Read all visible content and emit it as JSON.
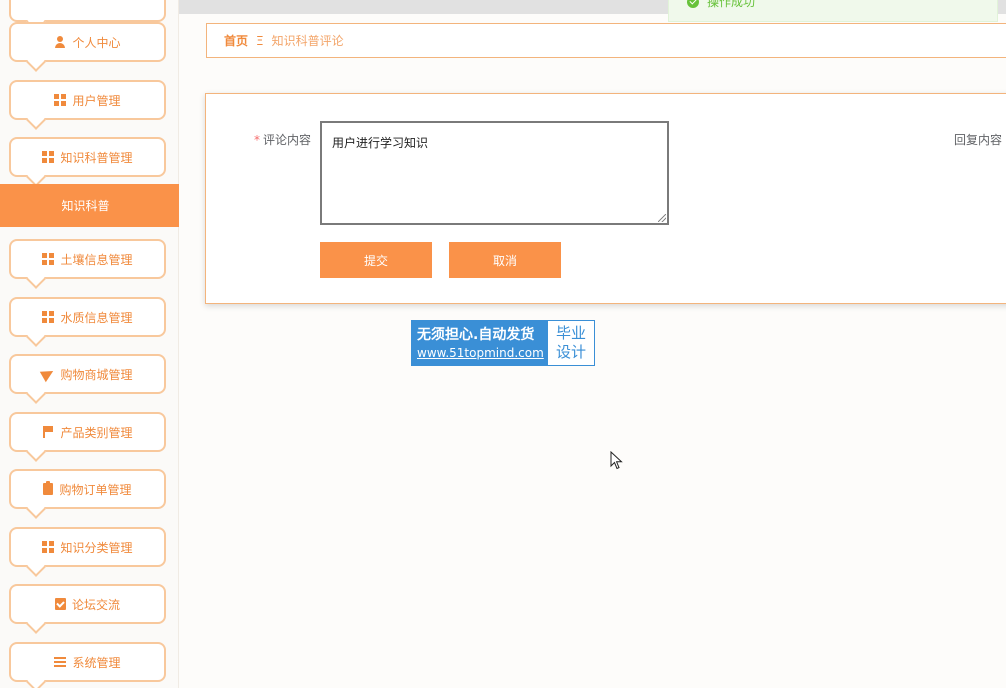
{
  "topbar": {
    "toast": "操作成功",
    "toast_color": "#67c23a"
  },
  "sidebar": {
    "accent": "#fa9249",
    "items": [
      {
        "label": "个人中心",
        "icon": "user-icon"
      },
      {
        "label": "用户管理",
        "icon": "grid-icon"
      },
      {
        "label": "知识科普管理",
        "icon": "grid-icon"
      },
      {
        "label": "土壤信息管理",
        "icon": "grid-icon"
      },
      {
        "label": "水质信息管理",
        "icon": "grid-icon"
      },
      {
        "label": "购物商城管理",
        "icon": "send-icon"
      },
      {
        "label": "产品类别管理",
        "icon": "flag-icon"
      },
      {
        "label": "购物订单管理",
        "icon": "clipboard-icon"
      },
      {
        "label": "知识分类管理",
        "icon": "grid-icon"
      },
      {
        "label": "论坛交流",
        "icon": "checklist-icon"
      },
      {
        "label": "系统管理",
        "icon": "list-icon"
      }
    ],
    "active_sub": "知识科普"
  },
  "breadcrumb": {
    "home": "首页",
    "separator": "Ξ",
    "current": "知识科普评论"
  },
  "form": {
    "comment_label": "评论内容",
    "required_mark": "*",
    "comment_value": "用户进行学习知识",
    "reply_label": "回复内容",
    "submit_label": "提交",
    "cancel_label": "取消"
  },
  "watermark": {
    "line1": "无须担心.自动发货",
    "line2": "www.51topmind.com",
    "right1": "毕业",
    "right2": "设计"
  }
}
